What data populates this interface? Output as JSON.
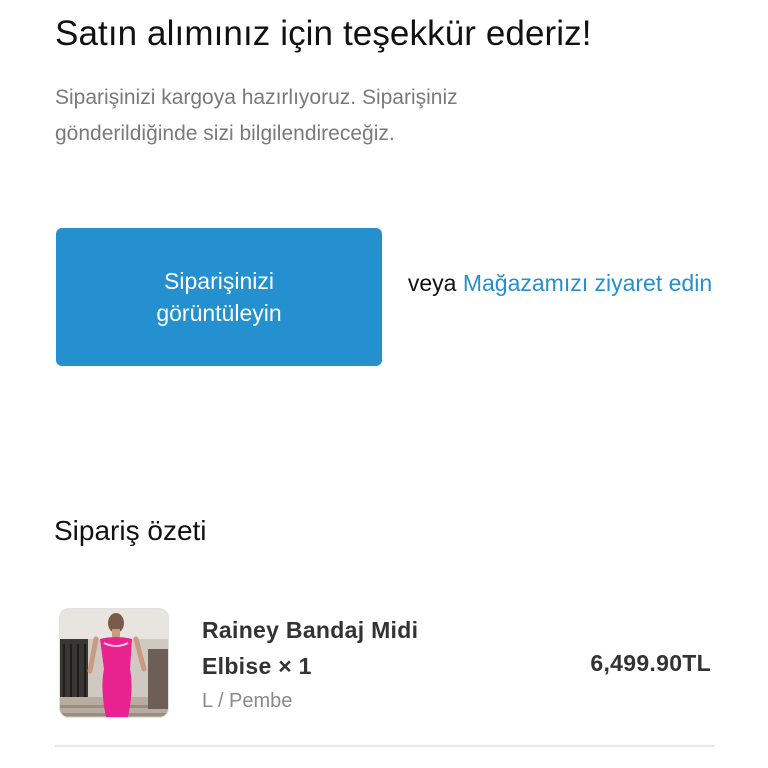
{
  "confirmation": {
    "title": "Satın alımınız için teşekkür ederiz!",
    "message": "Siparişinizi kargoya hazırlıyoruz. Siparişiniz gönderildiğinde sizi bilgilendireceğiz.",
    "view_order_button": "Siparişinizi görüntüleyin",
    "or_text": "veya",
    "visit_store_link": "Mağazamızı ziyaret edin"
  },
  "summary": {
    "heading": "Sipariş özeti",
    "items": [
      {
        "name": "Rainey Bandaj Midi Elbise",
        "quantity": "× 1",
        "variant": "L / Pembe",
        "price": "6,499.90TL"
      }
    ]
  },
  "colors": {
    "accent": "#2590cf",
    "muted_text": "#7a7a7a",
    "product_dress": "#e8238f"
  }
}
